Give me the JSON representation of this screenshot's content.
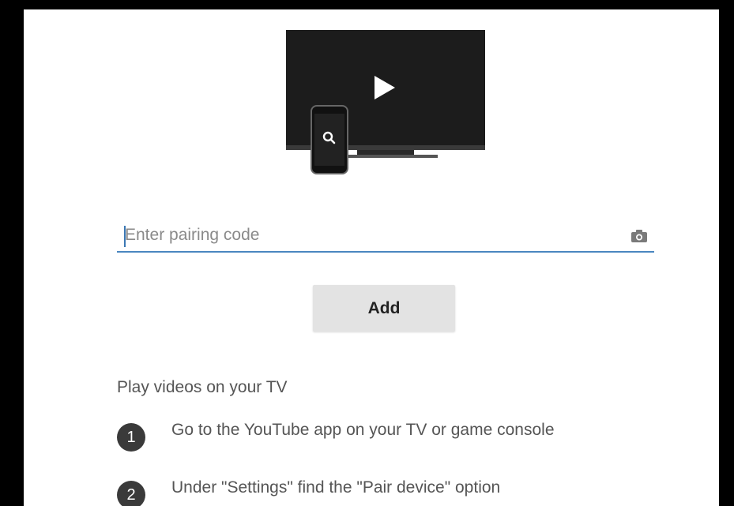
{
  "pairing": {
    "placeholder": "Enter pairing code",
    "value": ""
  },
  "add_button": {
    "label": "Add"
  },
  "instructions": {
    "title": "Play videos on your TV",
    "steps": [
      {
        "number": "1",
        "text": "Go to the YouTube app on your TV or game console"
      },
      {
        "number": "2",
        "text": "Under \"Settings\" find the \"Pair device\" option"
      }
    ]
  },
  "icons": {
    "illustration": "tv-with-phone-icon",
    "play": "play-icon",
    "search": "search-icon",
    "camera": "camera-icon"
  },
  "colors": {
    "accent": "#4a86c0",
    "tv_screen": "#1c1c1c",
    "button_bg": "#e3e3e3",
    "step_badge": "#3a3a3a"
  }
}
